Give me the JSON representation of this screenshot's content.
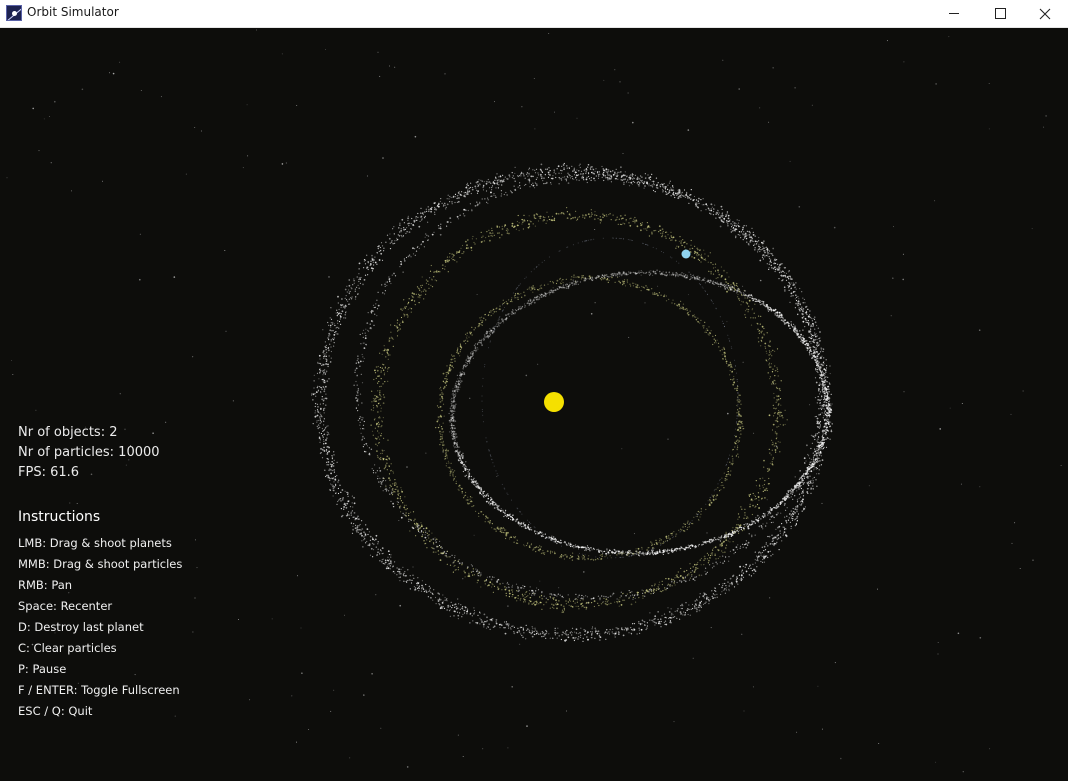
{
  "window": {
    "title": "Orbit Simulator"
  },
  "stats": {
    "objects": "Nr of objects: 2",
    "particles": "Nr of particles: 10000",
    "fps": "FPS: 61.6"
  },
  "instructions": {
    "title": "Instructions",
    "lines": [
      "LMB: Drag & shoot planets",
      "MMB: Drag & shoot particles",
      "RMB: Pan",
      "Space: Recenter",
      "D: Destroy last planet",
      "C: Clear particles",
      "P: Pause",
      "F / ENTER: Toggle Fullscreen",
      "ESC / Q: Quit"
    ]
  },
  "colors": {
    "background": "#0d0d0b",
    "sun": "#f5e000",
    "planet": "#8fd3ef",
    "particle_white": "#f2f2f2",
    "particle_yellow": "#d7d88a"
  }
}
